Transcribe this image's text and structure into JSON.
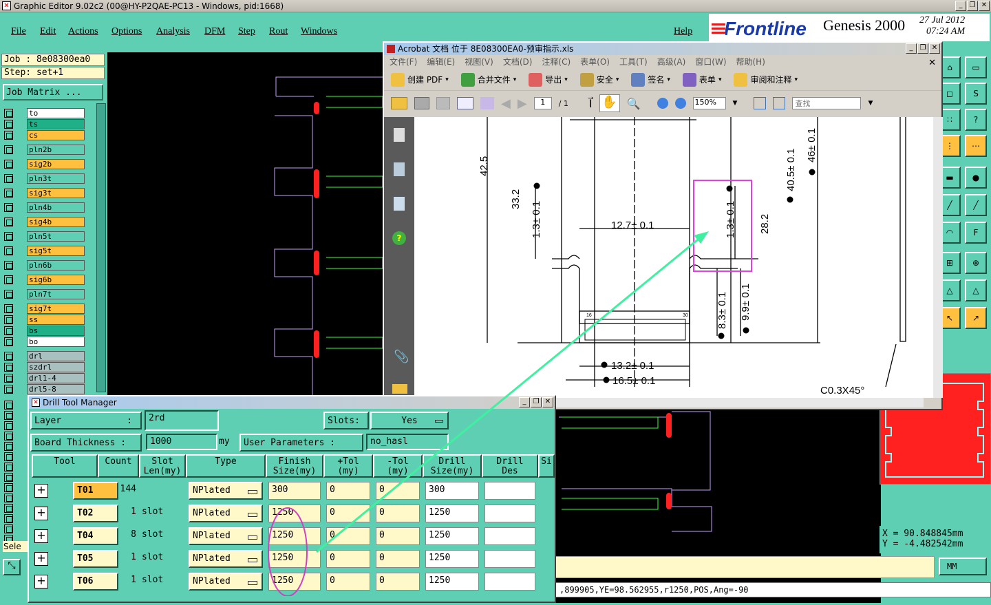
{
  "window": {
    "title": "Graphic Editor 9.02c2 (00@HY-P2QAE-PC13 - Windows, pid:1668)"
  },
  "menu": {
    "items": [
      "File",
      "Edit",
      "Actions",
      "Options",
      "Analysis",
      "DFM",
      "Step",
      "Rout",
      "Windows"
    ],
    "help": "Help"
  },
  "brand": {
    "logo": "Frontline",
    "product": "Genesis 2000",
    "date": "27 Jul 2012",
    "time": "07:24 AM"
  },
  "job": {
    "name": "Job : 8e08300ea0",
    "step": "Step: set+1",
    "matrix_button": "Job Matrix ..."
  },
  "layers": [
    {
      "name": "to",
      "color": "#ffffff"
    },
    {
      "name": "ts",
      "color": "#20b088"
    },
    {
      "name": "cs",
      "color": "#ffc040"
    },
    {
      "name": "pln2b",
      "color": "#5fcfb3"
    },
    {
      "name": "sig2b",
      "color": "#ffc040"
    },
    {
      "name": "pln3t",
      "color": "#5fcfb3"
    },
    {
      "name": "sig3t",
      "color": "#ffc040"
    },
    {
      "name": "pln4b",
      "color": "#5fcfb3"
    },
    {
      "name": "sig4b",
      "color": "#ffc040"
    },
    {
      "name": "pln5t",
      "color": "#5fcfb3"
    },
    {
      "name": "sig5t",
      "color": "#ffc040"
    },
    {
      "name": "pln6b",
      "color": "#5fcfb3"
    },
    {
      "name": "sig6b",
      "color": "#ffc040"
    },
    {
      "name": "pln7t",
      "color": "#5fcfb3"
    },
    {
      "name": "sig7t",
      "color": "#ffc040"
    },
    {
      "name": "ss",
      "color": "#ffc040"
    },
    {
      "name": "bs",
      "color": "#20b088"
    },
    {
      "name": "bo",
      "color": "#ffffff"
    },
    {
      "name": "drl",
      "color": "#a8c0c0"
    },
    {
      "name": "szdrl",
      "color": "#a8c0c0"
    },
    {
      "name": "drl1-4",
      "color": "#a8c0c0"
    },
    {
      "name": "drl5-8",
      "color": "#a8c0c0"
    }
  ],
  "left_misc": {
    "select_label": "Sele"
  },
  "coords": {
    "x": "X = 90.848845mm",
    "y": "Y = -4.482542mm"
  },
  "units": "MM",
  "status": ",899905,YE=98.562955,r1250,POS,Ang=-90",
  "acrobat": {
    "title": "Acrobat 文档 位于 8E08300EA0-预审指示.xls",
    "menu": [
      "文件(F)",
      "编辑(E)",
      "视图(V)",
      "文档(D)",
      "注释(C)",
      "表单(O)",
      "工具(T)",
      "高级(A)",
      "窗口(W)",
      "帮助(H)"
    ],
    "toolbar": [
      "创建 PDF",
      "合并文件",
      "导出",
      "安全",
      "签名",
      "表单",
      "审阅和注释"
    ],
    "page": "1",
    "pages": "/ 1",
    "zoom": "150%",
    "search_placeholder": "查找"
  },
  "drawing": {
    "dims": [
      "42.5",
      "33.2",
      "1.3± 0.1",
      "12.7± 0.1",
      "1.3± 0.1",
      "28.2",
      "40.5± 0.1",
      "46± 0.1",
      "8.3± 0.1",
      "9.9± 0.1",
      "13.2± 0.1",
      "16.5± 0.1",
      "C0.3X45°",
      "16",
      "30"
    ]
  },
  "dtm": {
    "title": "Drill Tool Manager",
    "layer_label": "Layer",
    "layer_colon": ":",
    "layer_value": "2rd",
    "slots_label": "Slots:",
    "slots_value": "Yes",
    "thickness_label": "Board Thickness :",
    "thickness_value": "1000",
    "thickness_unit": "my",
    "user_params_label": "User Parameters :",
    "user_params_value": "no_hasl",
    "headers": [
      "Tool",
      "Count",
      "Slot\nLen(my)",
      "Type",
      "Finish\nSize(my)",
      "+Tol\n(my)",
      "-Tol\n(my)",
      "Drill\nSize(my)",
      "Drill\nDes",
      "Si"
    ],
    "rows": [
      {
        "tool": "T01",
        "count": "144",
        "slot": "",
        "type": "NPlated",
        "finish": "300",
        "ptol": "0",
        "mtol": "0",
        "drill": "300",
        "des": ""
      },
      {
        "tool": "T02",
        "count": "1",
        "slot": "slot",
        "type": "NPlated",
        "finish": "1250",
        "ptol": "0",
        "mtol": "0",
        "drill": "1250",
        "des": ""
      },
      {
        "tool": "T04",
        "count": "8",
        "slot": "slot",
        "type": "NPlated",
        "finish": "1250",
        "ptol": "0",
        "mtol": "0",
        "drill": "1250",
        "des": ""
      },
      {
        "tool": "T05",
        "count": "1",
        "slot": "slot",
        "type": "NPlated",
        "finish": "1250",
        "ptol": "0",
        "mtol": "0",
        "drill": "1250",
        "des": ""
      },
      {
        "tool": "T06",
        "count": "1",
        "slot": "slot",
        "type": "NPlated",
        "finish": "1250",
        "ptol": "0",
        "mtol": "0",
        "drill": "1250",
        "des": ""
      }
    ]
  }
}
